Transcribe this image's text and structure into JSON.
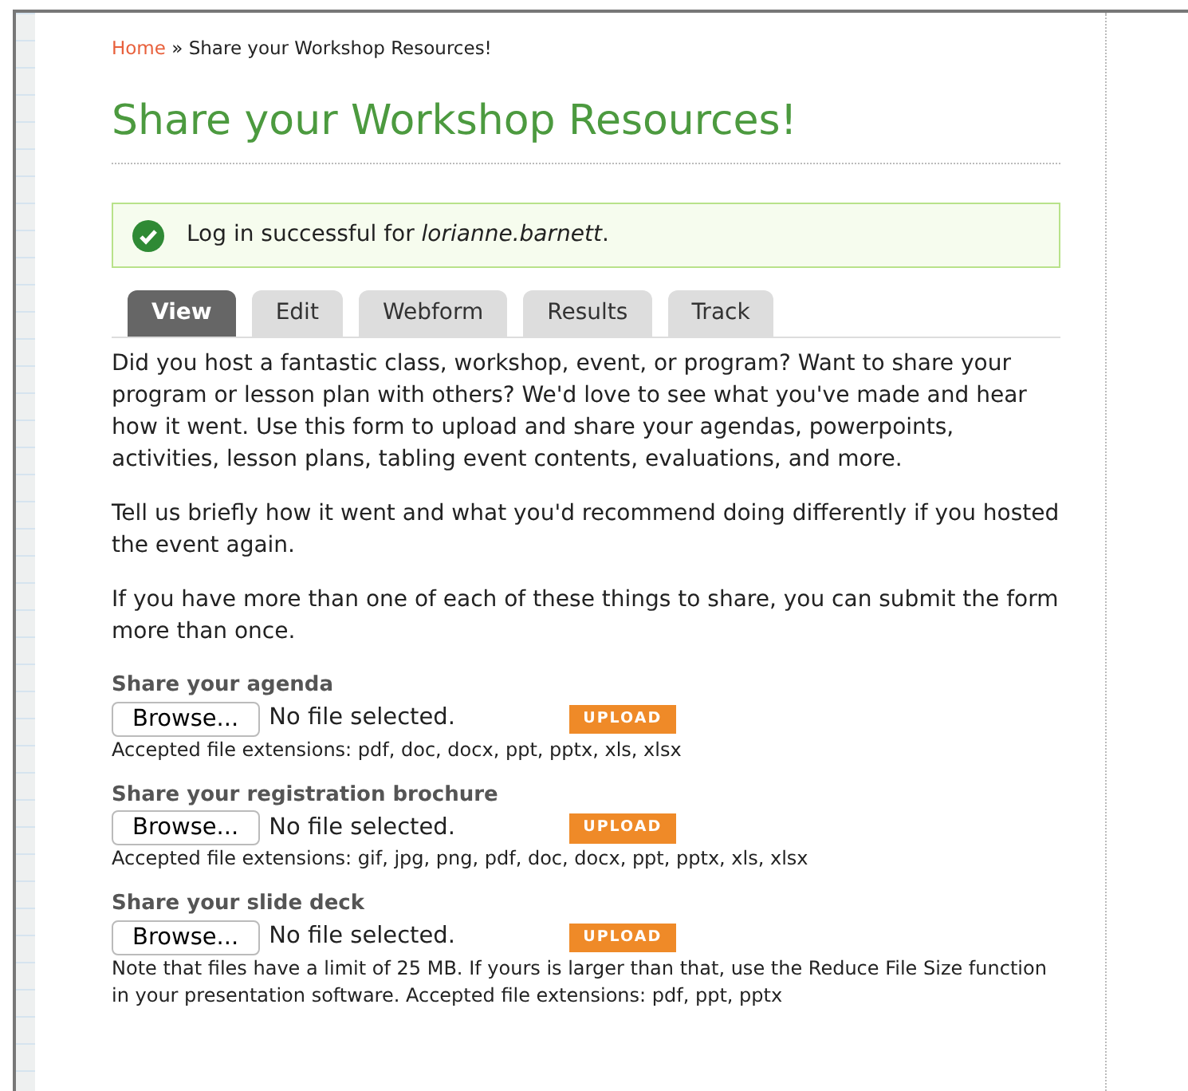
{
  "breadcrumb": {
    "home": "Home",
    "separator": "»",
    "current": "Share your Workshop Resources!"
  },
  "title": "Share your Workshop Resources!",
  "message": "Log in successful for *lorianne.barnett*.",
  "tabs": [
    {
      "label": "View",
      "selected": true
    },
    {
      "label": "Edit",
      "selected": false
    },
    {
      "label": "Webform",
      "selected": false
    },
    {
      "label": "Results",
      "selected": false
    },
    {
      "label": "Track",
      "selected": false
    }
  ],
  "intro": [
    "Did you host a fantastic class, workshop, event, or program? Want to share your program or lesson plan with others? We'd love to see what you've made and hear how it went. Use this form to upload and share your agendas, powerpoints, activities, lesson plans, tabling event contents, evaluations, and more.",
    "Tell us briefly how it went and what you'd recommend doing differently if you hosted the event again.",
    "If you have more than one of each of these things to share, you can submit the form more than once."
  ],
  "uploads": [
    {
      "label": "Share your agenda",
      "browse": "Browse...",
      "status": "No file selected.",
      "upload": "UPLOAD",
      "description": "Accepted file extensions: pdf, doc, docx, ppt, pptx, xls, xlsx"
    },
    {
      "label": "Share your registration brochure",
      "browse": "Browse...",
      "status": "No file selected.",
      "upload": "UPLOAD",
      "description": "Accepted file extensions: gif, jpg, png, pdf, doc, docx, ppt, pptx, xls, xlsx"
    },
    {
      "label": "Share your slide deck",
      "browse": "Browse...",
      "status": "No file selected.",
      "upload": "UPLOAD",
      "description": "Note that files have a limit of 25 MB. If yours is larger than that, use the Reduce File Size function in your presentation software. Accepted file extensions: pdf, ppt, pptx"
    }
  ]
}
